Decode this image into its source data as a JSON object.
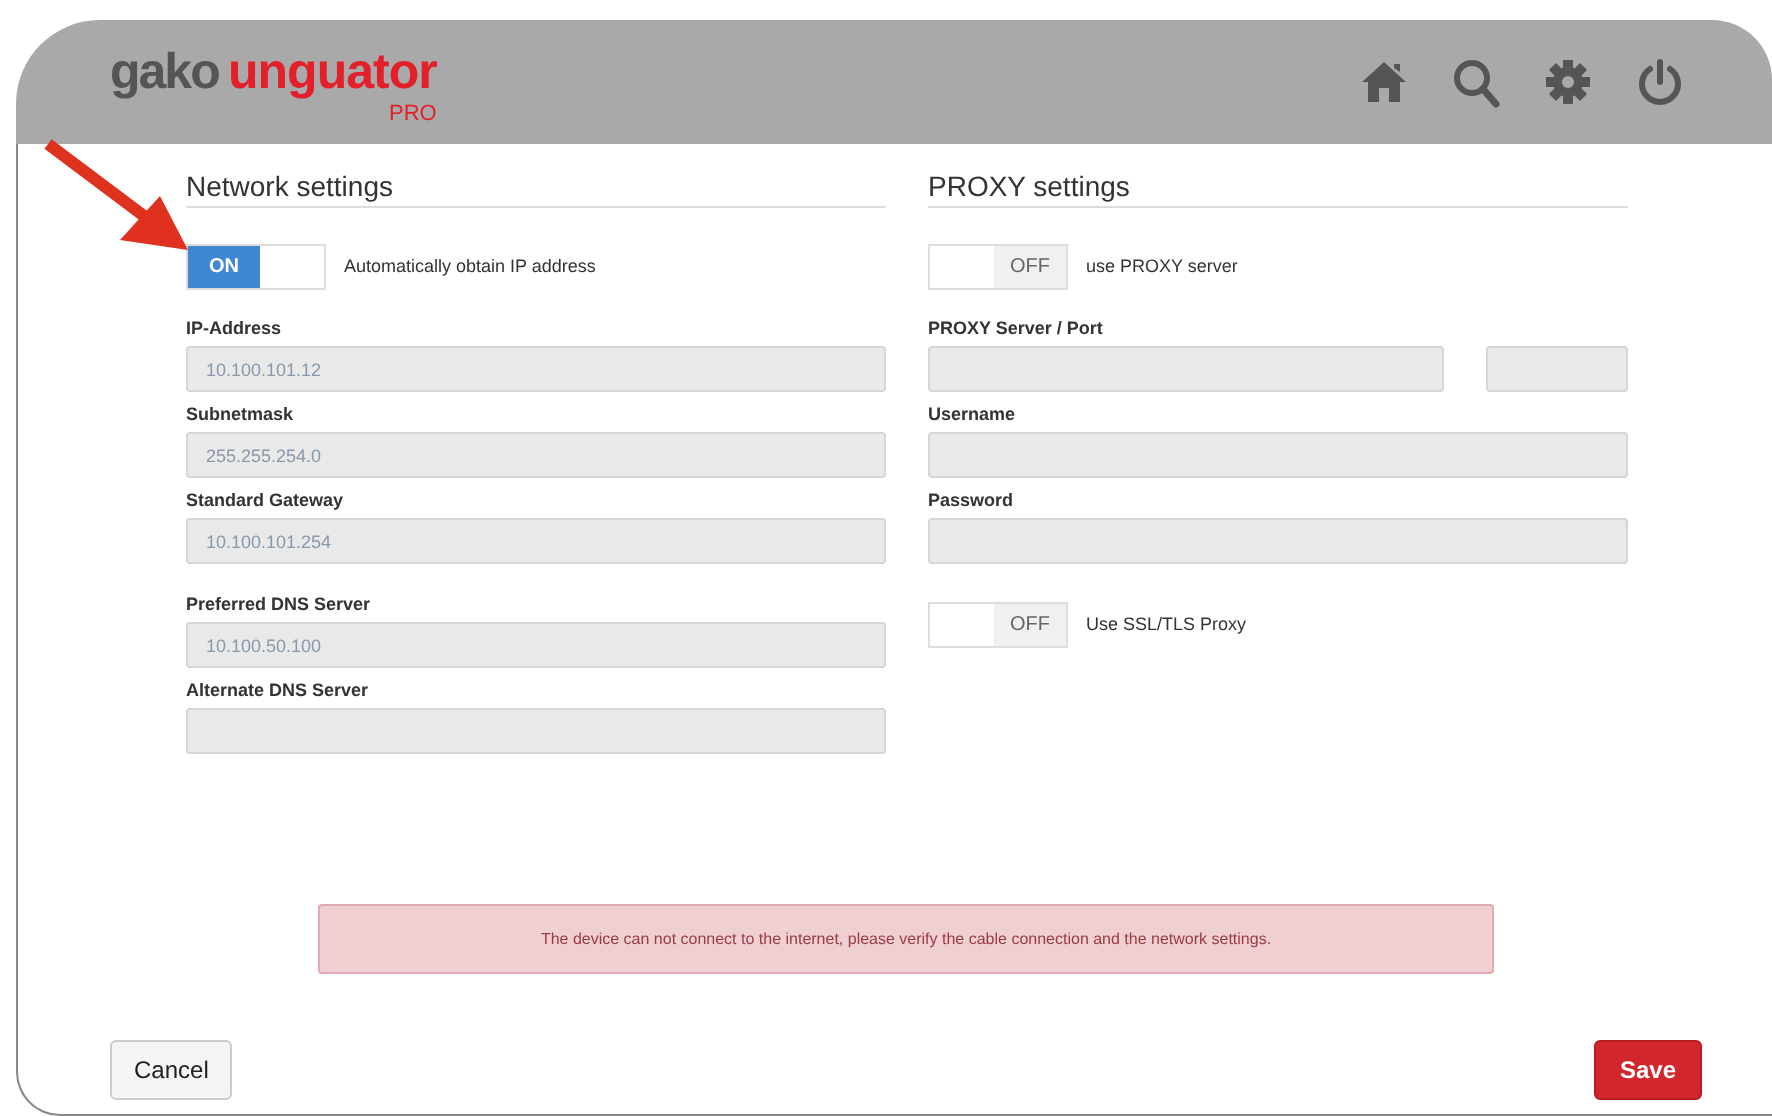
{
  "header": {
    "logo": {
      "brand": "gako",
      "product": "unguator",
      "edition": "PRO"
    }
  },
  "network": {
    "title": "Network settings",
    "toggle": {
      "state_label": "ON",
      "on": true,
      "label": "Automatically obtain IP address"
    },
    "address_fields": [
      {
        "label": "IP-Address",
        "value": "10.100.101.12"
      },
      {
        "label": "Subnetmask",
        "value": "255.255.254.0"
      },
      {
        "label": "Standard Gateway",
        "value": "10.100.101.254"
      }
    ],
    "dns_fields": [
      {
        "label": "Preferred DNS Server",
        "value": "10.100.50.100"
      },
      {
        "label": "Alternate DNS Server"
      }
    ]
  },
  "proxy": {
    "title": "PROXY settings",
    "items": [
      {
        "kind": "toggle",
        "state_label": "OFF",
        "on": false,
        "label": "use PROXY server"
      },
      {
        "kind": "pair",
        "label": "PROXY Server / Port"
      },
      {
        "kind": "field",
        "label": "Username"
      },
      {
        "kind": "field",
        "label": "Password"
      },
      {
        "kind": "toggle",
        "state_label": "OFF",
        "on": false,
        "label": "Use SSL/TLS Proxy"
      }
    ]
  },
  "alert": {
    "message": "The device can not connect to the internet, please verify the cable connection and the network settings."
  },
  "buttons": {
    "cancel": "Cancel",
    "save": "Save"
  }
}
